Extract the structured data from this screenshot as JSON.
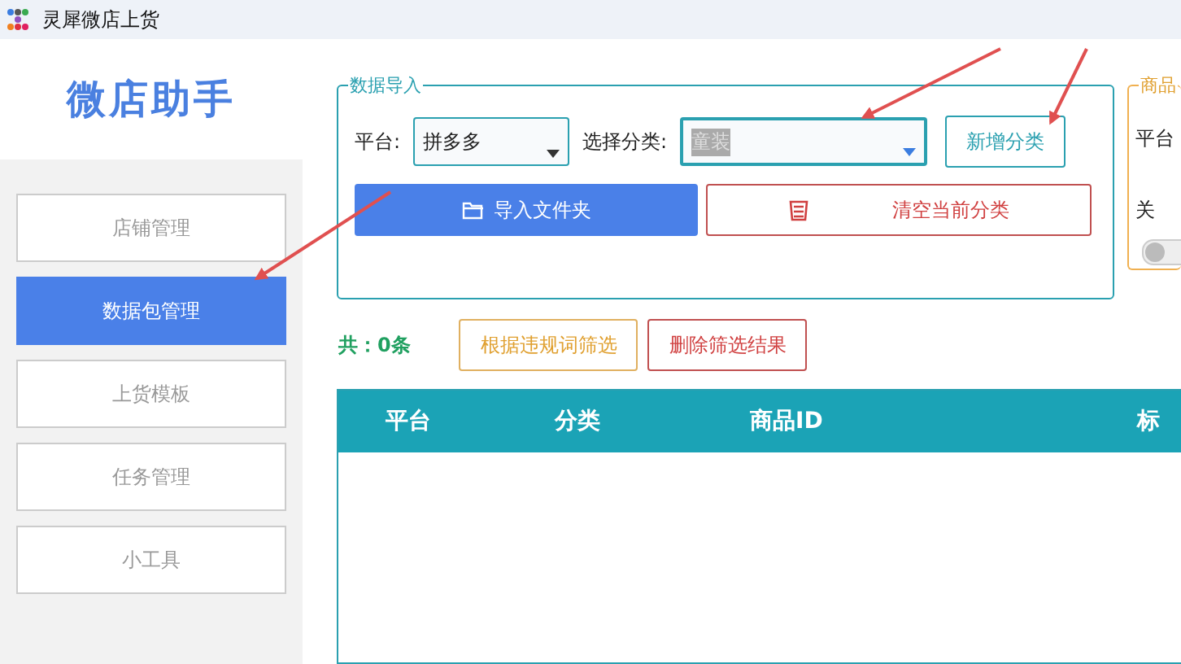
{
  "window": {
    "title": "灵犀微店上货"
  },
  "sidebar": {
    "logo": "微店助手",
    "items": [
      {
        "label": "店铺管理",
        "selected": false
      },
      {
        "label": "数据包管理",
        "selected": true
      },
      {
        "label": "上货模板",
        "selected": false
      },
      {
        "label": "任务管理",
        "selected": false
      },
      {
        "label": "小工具",
        "selected": false
      }
    ]
  },
  "import_group": {
    "legend": "数据导入",
    "platform_label": "平台:",
    "platform_value": "拼多多",
    "category_label": "选择分类:",
    "category_value": "童装",
    "add_button": "新增分类",
    "import_button": "导入文件夹",
    "clear_button": "清空当前分类"
  },
  "product_group": {
    "legend": "商品",
    "platform_label": "平台",
    "keyword_label": "关",
    "toggle_on": false
  },
  "toolbar": {
    "count": "共：0条",
    "filter_button": "根据违规词筛选",
    "delete_button": "删除筛选结果"
  },
  "table": {
    "columns": [
      "平台",
      "分类",
      "商品ID",
      "标"
    ]
  }
}
